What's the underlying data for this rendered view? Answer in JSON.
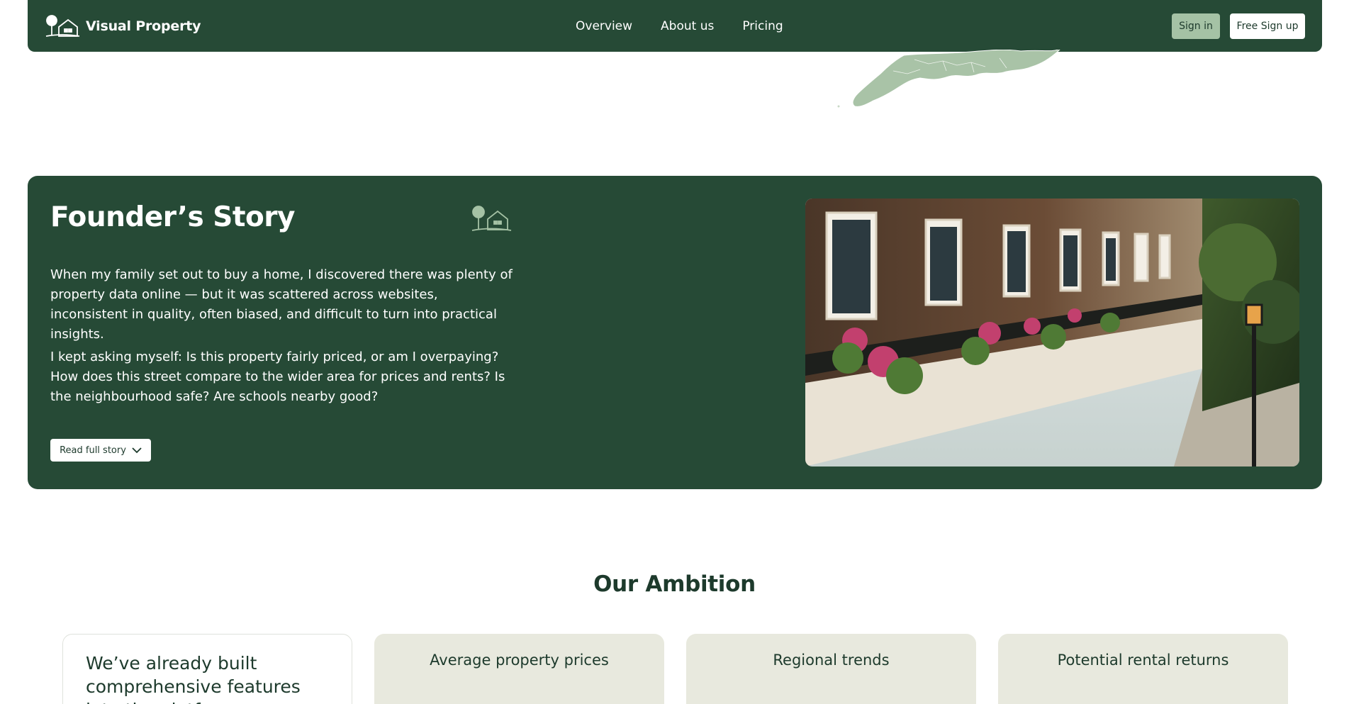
{
  "nav": {
    "brand": "Visual Property",
    "links": [
      "Overview",
      "About us",
      "Pricing"
    ],
    "signin": "Sign in",
    "signup": "Free Sign up"
  },
  "founder": {
    "title": "Founder’s Story",
    "paragraphs": [
      "When my family set out to buy a home, I discovered there was plenty of property data online — but it was scattered across websites, inconsistent in quality, often biased, and difficult to turn into practical insights.",
      "I kept asking myself: Is this property fairly priced, or am I overpaying? How does this street compare to the wider area for prices and rents? Is the neighbourhood safe? Are schools nearby good?"
    ],
    "read_more": "Read full story"
  },
  "ambition": {
    "title": "Our Ambition",
    "intro": "We’ve already built comprehensive features into the platform",
    "cards": [
      "Average property prices",
      "Regional trends",
      "Potential rental returns"
    ]
  },
  "colors": {
    "brand_green": "#264a36",
    "accent_sage": "#a5c2a5",
    "card_bg": "#e8e9de"
  },
  "icons": [
    "tree-house-logo-icon",
    "chevron-down-icon"
  ]
}
